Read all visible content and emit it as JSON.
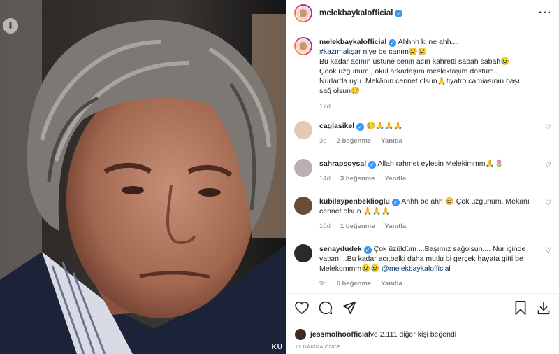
{
  "post": {
    "username": "melekbaykalofficial",
    "more_icon": "more-horizontal-icon"
  },
  "caption": {
    "username": "melekbaykalofficial",
    "line1": "Ahhhh ki ne ahh....",
    "hashtag": "#kazımakşar",
    "line2": " niye be canım😢😢",
    "line3": "Bu kadar acının üstüne senin acın kahretti sabah sabah😢",
    "line4": "Çook üzgünüm , okul arkadaşım meslektaşım dostum..",
    "line5": "Nurlarda uyu. Mekânın cennet olsun🙏tiyatro camiasının başı",
    "line6": "sağ olsun😢",
    "age": "17d"
  },
  "comments": [
    {
      "username": "caglasikel",
      "verified": true,
      "text": "😢🙏🙏🙏",
      "age": "3d",
      "likes": "2 beğenme",
      "reply": "Yanıtla",
      "avatar_color": "#e6c9b4"
    },
    {
      "username": "sahrapsoysal",
      "verified": true,
      "text": "Allah rahmet eylesin Melekimmm🙏🌷",
      "age": "14d",
      "likes": "3 beğenme",
      "reply": "Yanıtla",
      "avatar_color": "#b8b0b4"
    },
    {
      "username": "kubilaypenbeklioglu",
      "verified": true,
      "text": "Ahhh be ahh 😢 Çok üzgünüm. Mekanı cennet olsun 🙏🙏🙏",
      "age": "10d",
      "likes": "1 beğenme",
      "reply": "Yanıtla",
      "avatar_color": "#6b4a36"
    },
    {
      "username": "senaydudek",
      "verified": true,
      "text": "Çok üzüldüm ...Başımız sağolsun.... Nur içinde yatsın....Bu kadar acı,belki daha mutlu bi gerçek hayata gitti be Melekommm😢😢",
      "mention": "@melekbaykalofficial",
      "age": "9d",
      "likes": "6 beğenme",
      "reply": "Yanıtla",
      "avatar_color": "#2a2a2a"
    }
  ],
  "actions": {
    "icons": [
      "heart-icon",
      "comment-icon",
      "share-icon",
      "bookmark-icon",
      "download-icon"
    ]
  },
  "likes": {
    "user": "jessmolhoofficial",
    "rest": " ve 2.111 diğer kişi beğendi"
  },
  "timestamp": "17 DAKİKA ÖNCE",
  "photo": {
    "watermark": "KU"
  },
  "colors": {
    "link": "#00376b",
    "verified": "#3897f0",
    "muted": "#8e8e8e"
  }
}
